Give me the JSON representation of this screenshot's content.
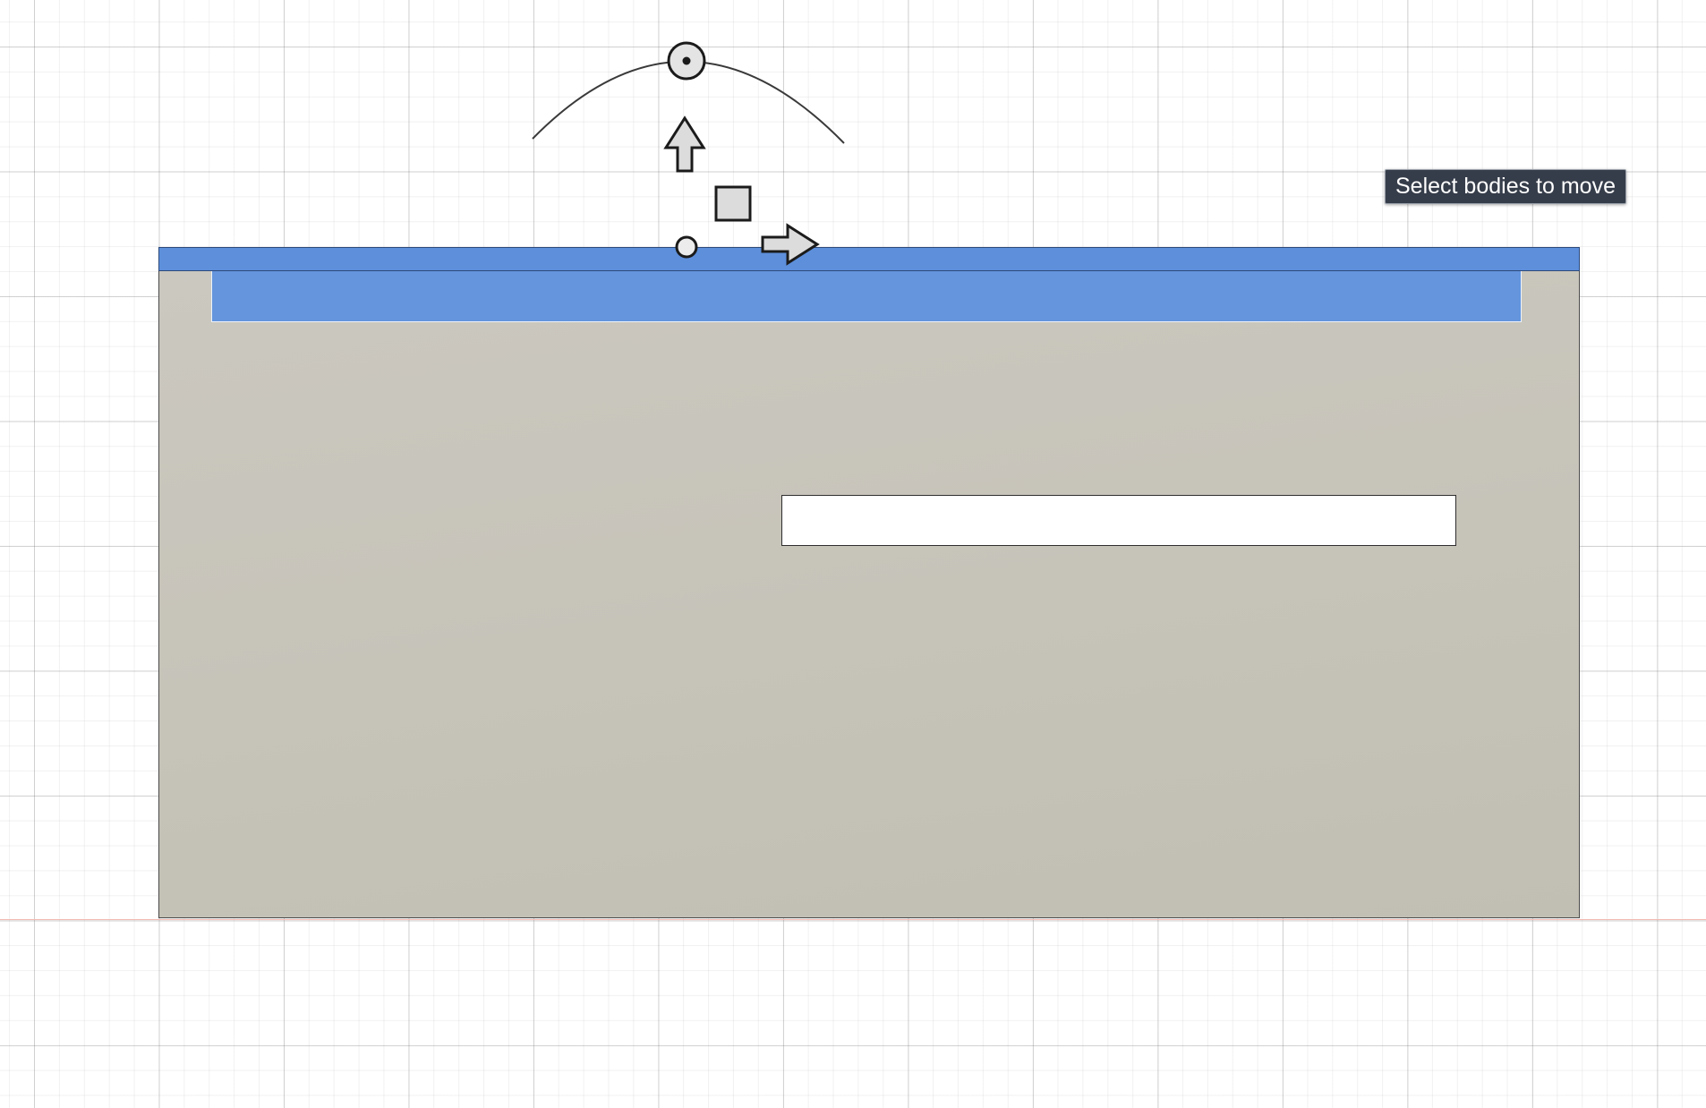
{
  "tooltip": {
    "text": "Select bodies to move"
  },
  "dimension_input": {
    "value": ""
  },
  "colors": {
    "selected_face": "#6495dd",
    "body": "#c7c4ba",
    "tooltip_bg": "#363d4a",
    "axis_line": "#f2b7b0"
  },
  "gizmo": {
    "handles": [
      "rotate-handle-icon",
      "move-up-arrow-icon",
      "planar-move-square-icon",
      "move-right-arrow-icon",
      "origin-point-icon"
    ]
  }
}
